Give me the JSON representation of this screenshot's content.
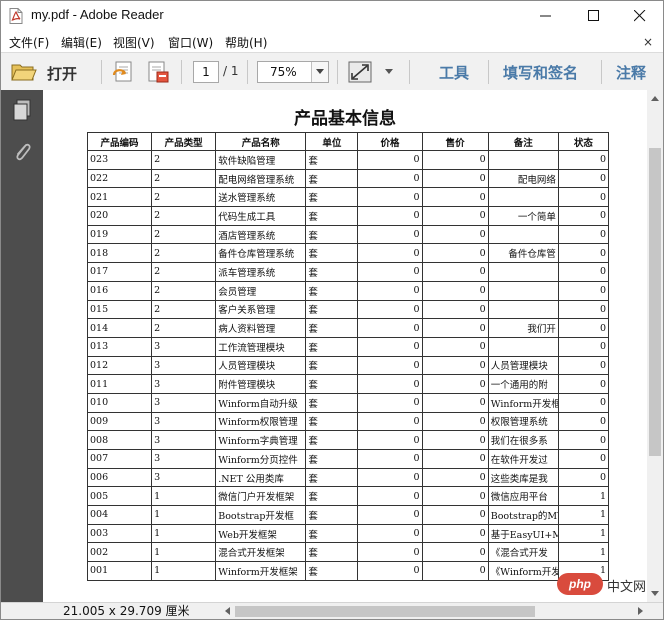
{
  "window": {
    "title": "my.pdf - Adobe Reader"
  },
  "menu": {
    "items": [
      "文件(F)",
      "编辑(E)",
      "视图(V)",
      "窗口(W)",
      "帮助(H)"
    ],
    "close_glyph": "×"
  },
  "toolbar": {
    "open_label": "打开",
    "page_current": "1",
    "page_total": "/ 1",
    "zoom": "75%",
    "tools_label": "工具",
    "fill_sign_label": "填写和签名",
    "comment_label": "注释"
  },
  "document": {
    "title": "产品基本信息",
    "columns": [
      "产品编码",
      "产品类型",
      "产品名称",
      "单位",
      "价格",
      "售价",
      "备注",
      "状态"
    ],
    "rows": [
      [
        "023",
        "2",
        "软件缺陷管理",
        "套",
        "0",
        "0",
        "",
        "0"
      ],
      [
        "022",
        "2",
        "配电网络管理系统",
        "套",
        "0",
        "0",
        "配电网络",
        "0"
      ],
      [
        "021",
        "2",
        "送水管理系统",
        "套",
        "0",
        "0",
        "",
        "0"
      ],
      [
        "020",
        "2",
        "代码生成工具",
        "套",
        "0",
        "0",
        "一个简单",
        "0"
      ],
      [
        "019",
        "2",
        "酒店管理系统",
        "套",
        "0",
        "0",
        "",
        "0"
      ],
      [
        "018",
        "2",
        "备件仓库管理系统",
        "套",
        "0",
        "0",
        "备件仓库管",
        "0"
      ],
      [
        "017",
        "2",
        "派车管理系统",
        "套",
        "0",
        "0",
        "",
        "0"
      ],
      [
        "016",
        "2",
        "会员管理",
        "套",
        "0",
        "0",
        "",
        "0"
      ],
      [
        "015",
        "2",
        "客户关系管理",
        "套",
        "0",
        "0",
        "",
        "0"
      ],
      [
        "014",
        "2",
        "病人资料管理",
        "套",
        "0",
        "0",
        "我们开",
        "0"
      ],
      [
        "013",
        "3",
        "工作流管理模块",
        "套",
        "0",
        "0",
        "",
        "0"
      ],
      [
        "012",
        "3",
        "人员管理模块",
        "套",
        "0",
        "0",
        "人员管理模块",
        "0"
      ],
      [
        "011",
        "3",
        "附件管理模块",
        "套",
        "0",
        "0",
        "一个通用的附",
        "0"
      ],
      [
        "010",
        "3",
        "Winform自动升级",
        "套",
        "0",
        "0",
        "Winform开发框",
        "0"
      ],
      [
        "009",
        "3",
        "Winform权限管理",
        "套",
        "0",
        "0",
        "权限管理系统",
        "0"
      ],
      [
        "008",
        "3",
        "Winform字典管理",
        "套",
        "0",
        "0",
        "我们在很多系",
        "0"
      ],
      [
        "007",
        "3",
        "Winform分页控件",
        "套",
        "0",
        "0",
        "在软件开发过",
        "0"
      ],
      [
        "006",
        "3",
        ".NET 公用类库",
        "套",
        "0",
        "0",
        "这些类库是我",
        "0"
      ],
      [
        "005",
        "1",
        "微信门户开发框架",
        "套",
        "0",
        "0",
        "微信应用平台",
        "1"
      ],
      [
        "004",
        "1",
        "Bootstrap开发框",
        "套",
        "0",
        "0",
        "Bootstrap的MV",
        "1"
      ],
      [
        "003",
        "1",
        "Web开发框架",
        "套",
        "0",
        "0",
        "基于EasyUI+MV",
        "1"
      ],
      [
        "002",
        "1",
        "混合式开发框架",
        "套",
        "0",
        "0",
        "《混合式开发",
        "1"
      ],
      [
        "001",
        "1",
        "Winform开发框架",
        "套",
        "0",
        "0",
        "《Winform开发",
        "1"
      ]
    ]
  },
  "status": {
    "page_size": "21.005 x 29.709 厘米"
  },
  "watermark": {
    "logo": "php",
    "site": "中文网"
  },
  "icons": {
    "app": "pdf-file-icon",
    "open": "folder-icon",
    "pages_panel": "pages-thumbnail-icon",
    "attachments_panel": "paperclip-icon"
  },
  "colors": {
    "sidebar": "#4d4d4d",
    "toolbar_link": "#4a7aa8",
    "toolbar_bg": "#f1f1f1"
  }
}
